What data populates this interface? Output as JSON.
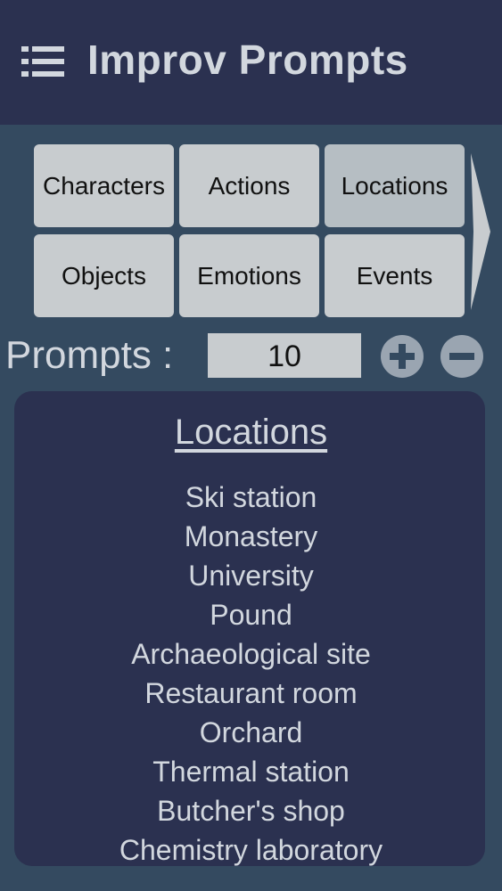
{
  "header": {
    "title": "Improv Prompts",
    "menu_icon": "hamburger-menu-icon"
  },
  "categories": [
    {
      "label": "Characters",
      "selected": false
    },
    {
      "label": "Actions",
      "selected": false
    },
    {
      "label": "Locations",
      "selected": true
    },
    {
      "label": "Objects",
      "selected": false
    },
    {
      "label": "Emotions",
      "selected": false
    },
    {
      "label": "Events",
      "selected": false
    }
  ],
  "prompts": {
    "label": "Prompts :",
    "count": "10",
    "increment_icon": "plus-circle-icon",
    "decrement_icon": "minus-circle-icon"
  },
  "result": {
    "title": "Locations",
    "items": [
      "Ski station",
      "Monastery",
      "University",
      "Pound",
      "Archaeological site",
      "Restaurant room",
      "Orchard",
      "Thermal station",
      "Butcher's shop",
      "Chemistry laboratory"
    ]
  },
  "colors": {
    "background": "#344a60",
    "header": "#2b3150",
    "button": "#c8cccf",
    "button_selected": "#b6bec3",
    "text_light": "#d2d7de",
    "icon": "#9aa5b1"
  }
}
